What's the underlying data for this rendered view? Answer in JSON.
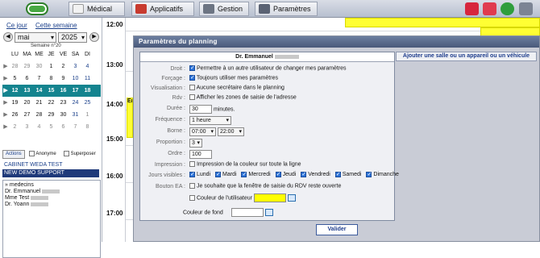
{
  "topbar": {
    "tabs": [
      {
        "label": "Médical",
        "icon": "medical-icon"
      },
      {
        "label": "Applicatifs",
        "icon": "apps-icon"
      },
      {
        "label": "Gestion",
        "icon": "gestion-icon"
      },
      {
        "label": "Paramètres",
        "icon": "settings-icon"
      }
    ],
    "right_icons": [
      "agenda-icon",
      "documents-icon",
      "refresh-icon",
      "close-icon"
    ]
  },
  "left": {
    "links": {
      "today": "Ce jour",
      "this_week": "Cette semaine"
    },
    "month": "mai",
    "year": "2025",
    "week_label": "Semaine n°20",
    "days_header": [
      "LU",
      "MA",
      "ME",
      "JE",
      "VE",
      "SA",
      "DI"
    ],
    "weeks": [
      [
        "28",
        "29",
        "30",
        "1",
        "2",
        "3",
        "4"
      ],
      [
        "5",
        "6",
        "7",
        "8",
        "9",
        "10",
        "11"
      ],
      [
        "12",
        "13",
        "14",
        "15",
        "16",
        "17",
        "18"
      ],
      [
        "19",
        "20",
        "21",
        "22",
        "23",
        "24",
        "25"
      ],
      [
        "26",
        "27",
        "28",
        "29",
        "30",
        "31",
        "1"
      ],
      [
        "2",
        "3",
        "4",
        "5",
        "6",
        "7",
        "8"
      ]
    ],
    "actions_label": "Actions",
    "anonyme_label": "Anonyme",
    "superposer_label": "Superposer",
    "cabinet": "CABINET WEDA TEST",
    "demo": "NEW DEMO SUPPORT",
    "medecins_label": "medecins",
    "doctors": [
      "Dr. Emmanuel",
      "Mme Test",
      "Dr. Yoann"
    ]
  },
  "schedule": {
    "times": [
      "12:00",
      "13:00",
      "14:00",
      "15:00",
      "16:00",
      "17:00"
    ],
    "appointment_snip": "Em"
  },
  "modal": {
    "title": "Paramètres du planning",
    "add_button": "Ajouter une salle ou un appareil ou un véhicule",
    "doctor": "Dr. Emmanuel",
    "droit_label": "Droit :",
    "droit_text": "Permettre à un autre utilisateur de changer mes paramètres",
    "forcage_label": "Forçage :",
    "forcage_text": "Toujours utiliser mes paramètres",
    "visualisation_label": "Visualisation :",
    "visualisation_text": "Aucune secrétaire dans le planning",
    "rdv_label": "Rdv :",
    "rdv_text": "Afficher les zones de saisie de l'adresse",
    "duree_label": "Durée :",
    "duree_value": "30",
    "duree_unit": "minutes.",
    "frequence_label": "Fréquence :",
    "frequence_value": "1 heure",
    "borne_label": "Borne :",
    "borne_start": "07:00",
    "borne_end": "22:00",
    "proportion_label": "Proportion :",
    "proportion_value": "3",
    "ordre_label": "Ordre :",
    "ordre_value": "100",
    "impression_label": "Impression :",
    "impression_text": "Impression de la couleur sur toute la ligne",
    "jours_label": "Jours visibles :",
    "days": [
      "Lundi",
      "Mardi",
      "Mercredi",
      "Jeudi",
      "Vendredi",
      "Samedi",
      "Dimanche"
    ],
    "bouton_label": "Bouton EA :",
    "bouton_text": "Je souhaite que la fenêtre de saisie du RDV reste ouverte",
    "couleur_label": "Couleur de l'utilisateur",
    "couleur_value": "#ffff00",
    "fond_label": "Couleur de fond",
    "valider": "Valider"
  },
  "colors": {
    "accent": "#14848f",
    "yellow": "#ffff33",
    "title_bar": "#49597a"
  }
}
